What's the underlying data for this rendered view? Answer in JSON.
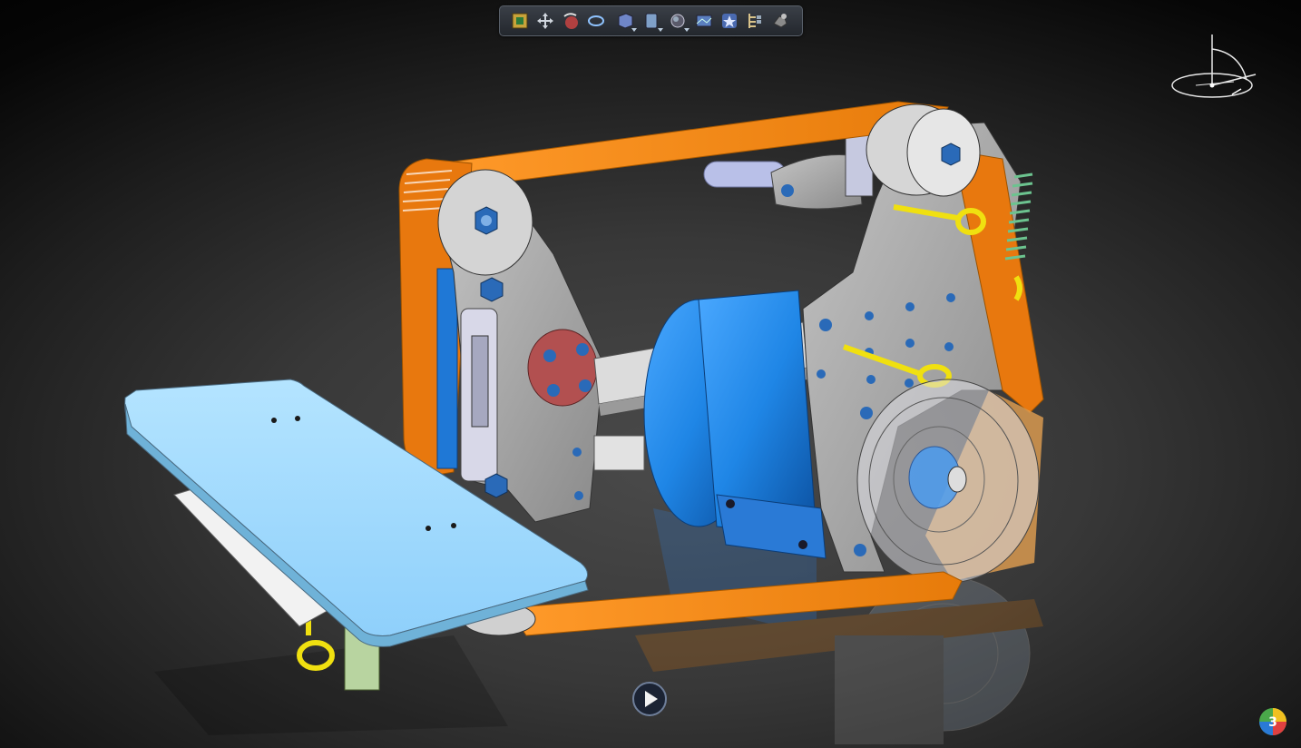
{
  "viewer": {
    "background": "#3c3c3c",
    "toolbar": {
      "tools": [
        {
          "name": "fit-all-icon"
        },
        {
          "name": "pan-icon"
        },
        {
          "name": "rotate-icon"
        },
        {
          "name": "zoom-icon"
        },
        {
          "name": "view-box-icon",
          "dropdown": true
        },
        {
          "name": "view-mode-icon",
          "dropdown": true
        },
        {
          "name": "render-style-icon",
          "dropdown": true
        },
        {
          "name": "lighting-icon"
        },
        {
          "name": "favorites-icon"
        },
        {
          "name": "tree-icon"
        },
        {
          "name": "properties-icon"
        }
      ]
    },
    "compass": {
      "name": "compass-icon"
    },
    "play_button": {
      "name": "play-icon"
    },
    "brand_logo": {
      "name": "3dexperience-logo"
    }
  },
  "model": {
    "colors": {
      "belt": "#f0820f",
      "belt_highlight": "#ffb03a",
      "plate": "#a8a8a8",
      "plate_dark": "#7f7f7f",
      "motor": "#1f86e6",
      "table": "#9fd8ff",
      "spring": "#7fcfa0",
      "eyebolt": "#f0e010",
      "bolt": "#2a6ab8",
      "hub": "#b25050"
    }
  }
}
